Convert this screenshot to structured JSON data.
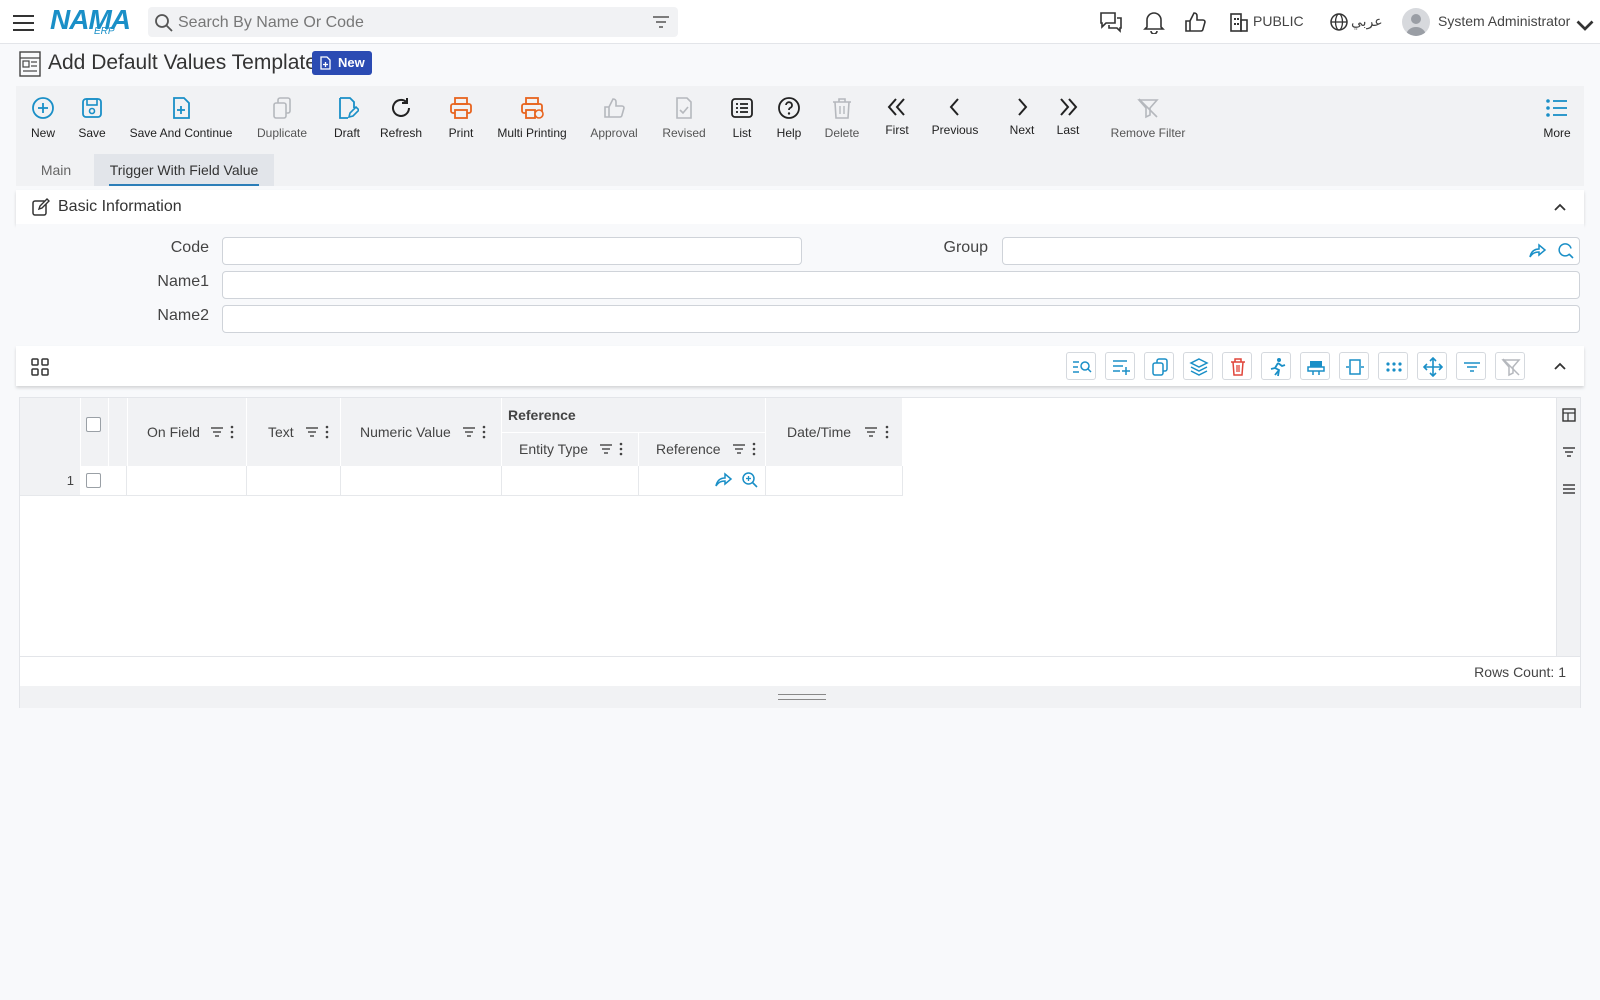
{
  "header": {
    "logo_text": "NAMA",
    "logo_sub": "ERP",
    "search_placeholder": "Search By Name Or Code",
    "company": "PUBLIC",
    "language": "عربي",
    "user": "System Administrator"
  },
  "page": {
    "title": "Add Default Values Template",
    "badge": "New"
  },
  "toolbar": {
    "new": "New",
    "save": "Save",
    "save_continue": "Save And Continue",
    "duplicate": "Duplicate",
    "draft": "Draft",
    "refresh": "Refresh",
    "print": "Print",
    "multi_printing": "Multi Printing",
    "approval": "Approval",
    "revised": "Revised",
    "list": "List",
    "help": "Help",
    "delete": "Delete",
    "first": "First",
    "previous": "Previous",
    "next": "Next",
    "last": "Last",
    "remove_filter": "Remove Filter",
    "more": "More"
  },
  "tabs": [
    "Main",
    "Trigger With Field Value"
  ],
  "section": {
    "title": "Basic Information",
    "fields": {
      "code": "Code",
      "group": "Group",
      "name1": "Name1",
      "name2": "Name2"
    }
  },
  "grid": {
    "columns": {
      "on_field": "On Field",
      "text": "Text",
      "numeric_value": "Numeric Value",
      "reference_group": "Reference",
      "entity_type": "Entity Type",
      "reference": "Reference",
      "date_time": "Date/Time"
    },
    "rows": [
      {
        "index": "1"
      }
    ],
    "rows_count": "Rows Count: 1"
  },
  "colors": {
    "accent": "#1a8fc7",
    "print": "#e8641e",
    "badge": "#2b4bb3",
    "danger": "#e0453a"
  }
}
